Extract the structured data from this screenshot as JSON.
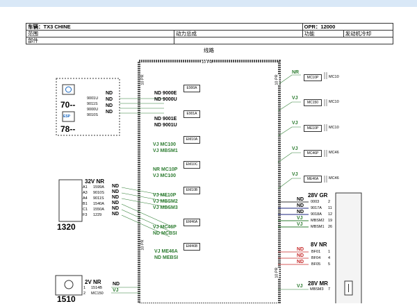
{
  "header": {
    "vehicle_label": "车辆：TX3 CHINE",
    "opr_label": "OPR：12000",
    "scope_label": "范围",
    "scope_value": "动力总成",
    "function_label": "功能",
    "function_value": "发动机冷却",
    "part_label": "部件"
  },
  "diagram": {
    "title": "线路",
    "harness_top": "10 PR",
    "harness_left_1": "10 PR",
    "harness_left_2": "10 PR",
    "harness_right_1": "10 PR",
    "harness_right_2": "10 PR",
    "left_module": {
      "id1": "70--",
      "id2": "78--",
      "esp": "ESP",
      "pins": [
        "9001U",
        "9011S",
        "9000U",
        "9010S"
      ],
      "wires": [
        "ND",
        "ND",
        "ND",
        "ND"
      ]
    },
    "splices": [
      {
        "id": "E900A",
        "wires": [
          "ND 9000E",
          "ND 9000U"
        ]
      },
      {
        "id": "E901A",
        "wires": [
          "ND 9001E",
          "ND 9001U"
        ]
      },
      {
        "id": "EM10A",
        "wires": [
          "VJ MC100",
          "VJ MBSM1"
        ]
      },
      {
        "id": "EM10C",
        "wires": [
          "NR MC10P",
          "VJ MC100"
        ]
      },
      {
        "id": "EM10B",
        "wires": [
          "VJ ME10P",
          "VJ MBSM2",
          "VJ MBSM3"
        ]
      },
      {
        "id": "EM46A",
        "wires": [
          "VJ MC46P",
          "ND MCBSI"
        ]
      },
      {
        "id": "EM46B",
        "wires": [
          "VJ ME46A",
          "ND MEBSI"
        ]
      }
    ],
    "right_wires": [
      {
        "color": "NR",
        "ref": "MC10P",
        "dest": "MC10"
      },
      {
        "color": "VJ",
        "ref": "MC150",
        "dest": "MC10"
      },
      {
        "color": "VJ",
        "ref": "ME10P",
        "dest": "MC10"
      },
      {
        "color": "VJ",
        "ref": "MC46P",
        "dest": "MC46"
      },
      {
        "color": "VJ",
        "ref": "ME46A",
        "dest": "MC46"
      }
    ],
    "connector_1320": {
      "id": "1320",
      "type": "32V NR",
      "rows": [
        {
          "pin": "A1",
          "ref": "1599A",
          "wire": "ND"
        },
        {
          "pin": "A3",
          "ref": "9010S",
          "wire": "ND"
        },
        {
          "pin": "A4",
          "ref": "9011S",
          "wire": "ND"
        },
        {
          "pin": "B1",
          "ref": "1540A",
          "wire": "ND"
        },
        {
          "pin": "C1",
          "ref": "1550A",
          "wire": "ND"
        },
        {
          "pin": "F3",
          "ref": "1229",
          "wire": "ND"
        }
      ]
    },
    "connector_1510": {
      "id": "1510",
      "type": "2V NR",
      "rows": [
        {
          "pin": "1",
          "ref": "1514B",
          "wire": "ND"
        },
        {
          "pin": "2",
          "ref": "MC150",
          "wire": "VJ"
        }
      ]
    },
    "connector_28v_gr": {
      "type": "28V GR",
      "rows": [
        {
          "wire": "ND",
          "ref": "0003",
          "pin": "2"
        },
        {
          "wire": "ND",
          "ref": "9017A",
          "pin": "11"
        },
        {
          "wire": "ND",
          "ref": "9018A",
          "pin": "12"
        },
        {
          "wire": "VJ",
          "ref": "MBSM2",
          "pin": "19"
        },
        {
          "wire": "VJ",
          "ref": "MBSM1",
          "pin": "26"
        }
      ]
    },
    "connector_8v_nr": {
      "type": "8V NR",
      "rows": [
        {
          "wire": "ND",
          "ref": "BF01",
          "pin": "1"
        },
        {
          "wire": "ND",
          "ref": "BF04",
          "pin": "4"
        },
        {
          "wire": "ND",
          "ref": "BF05",
          "pin": "5"
        }
      ]
    },
    "connector_28v_mr": {
      "type": "28V MR",
      "rows": [
        {
          "wire": "VJ",
          "ref": "MBSM3",
          "pin": "7"
        }
      ]
    }
  }
}
